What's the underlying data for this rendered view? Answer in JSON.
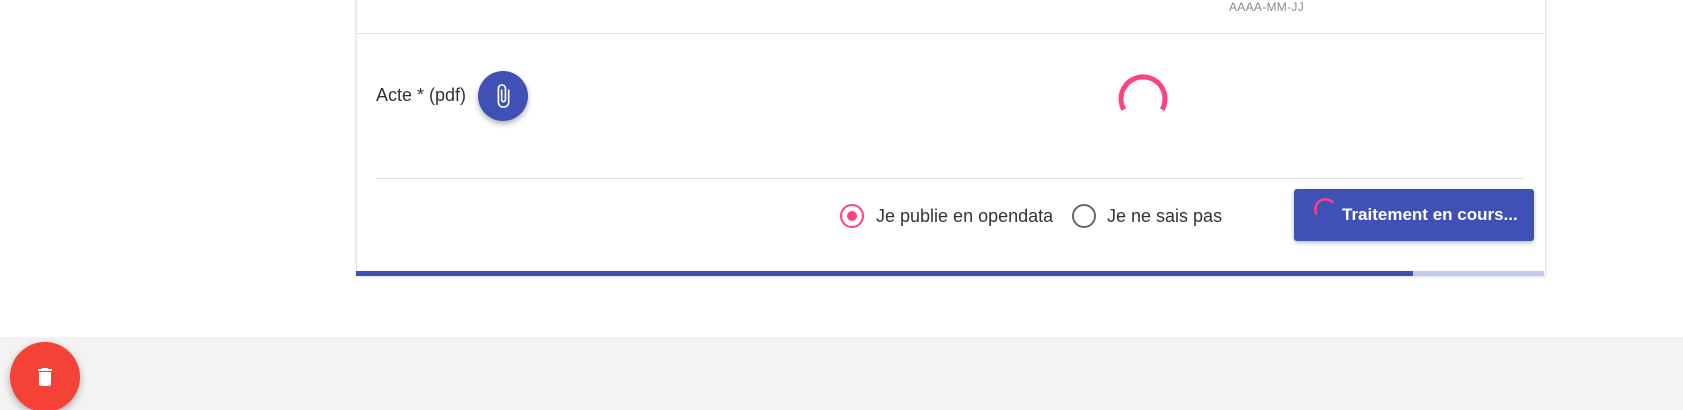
{
  "form": {
    "date_hint": "AAAA-MM-JJ",
    "acte_label": "Acte * (pdf)",
    "attach_icon": "paperclip-icon",
    "loading_icon": "spinner-icon"
  },
  "publication": {
    "options": [
      {
        "label": "Je publie en opendata",
        "checked": true
      },
      {
        "label": "Je ne sais pas",
        "checked": false
      }
    ]
  },
  "submit": {
    "label": "Traitement en cours...",
    "icon": "spinner-icon"
  },
  "progress": {
    "percent": 89
  },
  "actions": {
    "delete_icon": "trash-icon"
  },
  "colors": {
    "primary": "#3f51b5",
    "accent": "#ff4081",
    "danger": "#f44336",
    "progress_track": "#c5cae9"
  }
}
